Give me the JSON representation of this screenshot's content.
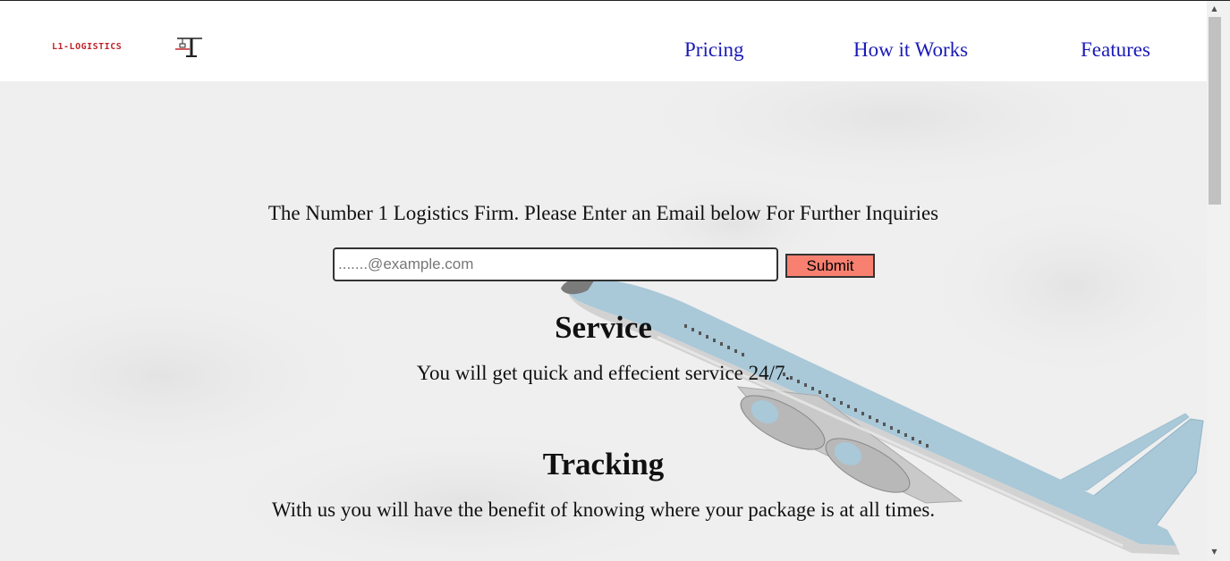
{
  "brand": {
    "logo_text": "L1-LOGISTICS"
  },
  "nav": {
    "items": [
      {
        "label": "Pricing"
      },
      {
        "label": "How it Works"
      },
      {
        "label": "Features"
      }
    ]
  },
  "hero": {
    "tagline": "The Number 1 Logistics Firm. Please Enter an Email below For Further Inquiries",
    "email_placeholder": ".......@example.com",
    "email_value": "",
    "submit_label": "Submit"
  },
  "sections": [
    {
      "title": "Service",
      "text": "You will get quick and effecient service 24/7."
    },
    {
      "title": "Tracking",
      "text": "With us you will have the benefit of knowing where your package is at all times."
    }
  ],
  "colors": {
    "nav_link": "#1a1ab8",
    "submit_bg": "#f88070",
    "hero_bg": "#efefef",
    "logo_red": "#c0252b",
    "plane_blue": "#a9c8d8"
  },
  "icons": {
    "logo_crane": "crane-icon",
    "scroll_up": "up-arrow-icon",
    "scroll_down": "down-arrow-icon"
  },
  "scrollbar": {
    "up_arrow": "▲",
    "down_arrow": "▼"
  }
}
